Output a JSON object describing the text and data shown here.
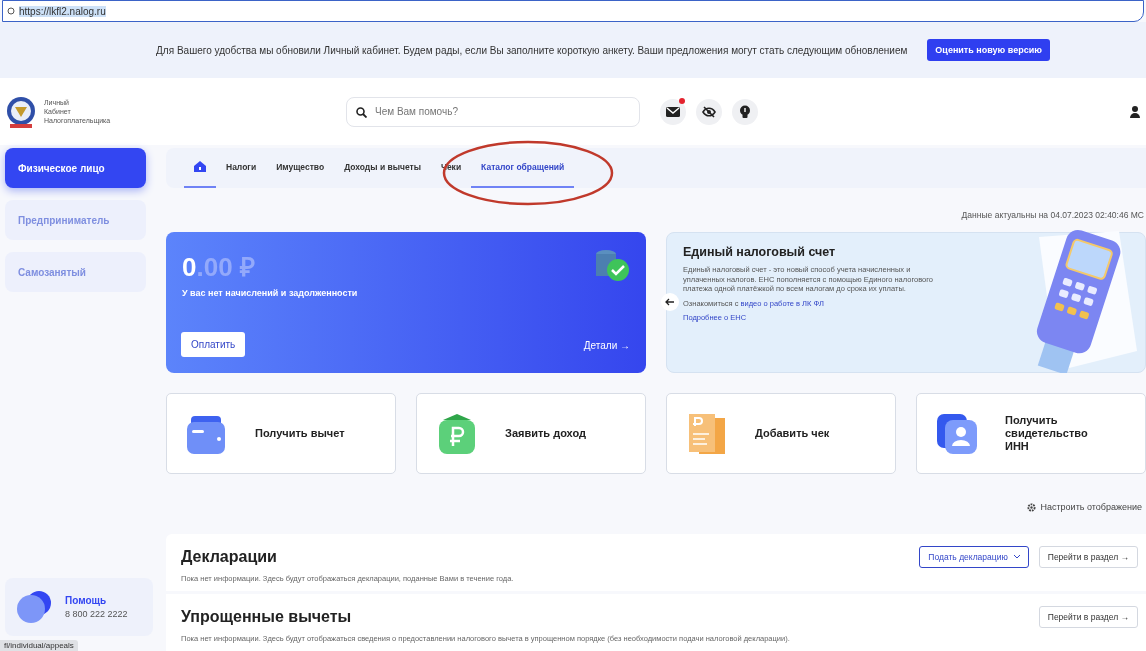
{
  "address_bar": {
    "url": "https://lkfl2.nalog.ru"
  },
  "banner": {
    "text": "Для Вашего удобства мы обновили Личный кабинет. Будем рады, если Вы заполните короткую анкету. Ваши предложения могут стать следующим обновлением",
    "button": "Оценить новую версию"
  },
  "header": {
    "logo_lines": [
      "Личный",
      "Кабинет",
      "Налогоплательщика"
    ],
    "search": {
      "placeholder": "Чем Вам помочь?"
    },
    "icons": [
      {
        "kind": "mail",
        "badge": true
      },
      {
        "kind": "eye-off",
        "badge": false
      },
      {
        "kind": "bulb",
        "badge": false
      }
    ]
  },
  "sidebar": {
    "items": [
      {
        "label": "Физическое лицо",
        "selected": true
      },
      {
        "label": "Предприниматель",
        "selected": false
      },
      {
        "label": "Самозанятый",
        "selected": false
      }
    ],
    "help": {
      "title": "Помощь",
      "phone": "8 800 222 2222"
    }
  },
  "main_nav": {
    "tabs": [
      {
        "kind": "home",
        "selected": true
      },
      {
        "kind": "text",
        "label": "Налоги",
        "selected": false
      },
      {
        "kind": "text",
        "label": "Имущество",
        "selected": false
      },
      {
        "kind": "text",
        "label": "Доходы и вычеты",
        "selected": false
      },
      {
        "kind": "text",
        "label": "Чеки",
        "selected": false
      },
      {
        "kind": "text",
        "label": "Каталог обращений",
        "selected": true
      }
    ]
  },
  "updated_text": "Данные актуальны на 04.07.2023 02:40:46 МС",
  "balance_card": {
    "amount_int": "0",
    "amount_frac": ".00 ₽",
    "caption": "У вас нет начислений и задолженности",
    "pay_button": "Оплатить",
    "details_link": "Детали →"
  },
  "ens_card": {
    "title": "Единый налоговый счет",
    "text": "Единый налоговый счет - это новый способ учета начисленных и уплаченных налогов. ЕНС пополняется с помощью Единого налогового платежа одной платёжкой по всем налогам до срока их уплаты.",
    "video_prefix": "Ознакомиться с",
    "video_link": "видео о работе в ЛК ФЛ",
    "more_link": "Подробнее о ЕНС"
  },
  "actions": [
    {
      "kind": "wallet",
      "label": "Получить вычет"
    },
    {
      "kind": "ruble",
      "label": "Заявить доход"
    },
    {
      "kind": "receipt",
      "label": "Добавить чек"
    },
    {
      "kind": "id",
      "label": "Получить свидетельство ИНН"
    }
  ],
  "settings_link": "Настроить отображение",
  "sections": [
    {
      "title": "Декларации",
      "text": "Пока нет информации. Здесь будут отображаться декларации, поданные Вами в течение года.",
      "primary_button": "Подать декларацию",
      "link_button": "Перейти в раздел →"
    },
    {
      "title": "Упрощенные вычеты",
      "text": "Пока нет информации. Здесь будут отображаться сведения о предоставлении налогового вычета в упрощенном порядке (без необходимости подачи налоговой декларации).",
      "link_button": "Перейти в раздел →"
    }
  ],
  "status_url": "fl/individual/appeals"
}
